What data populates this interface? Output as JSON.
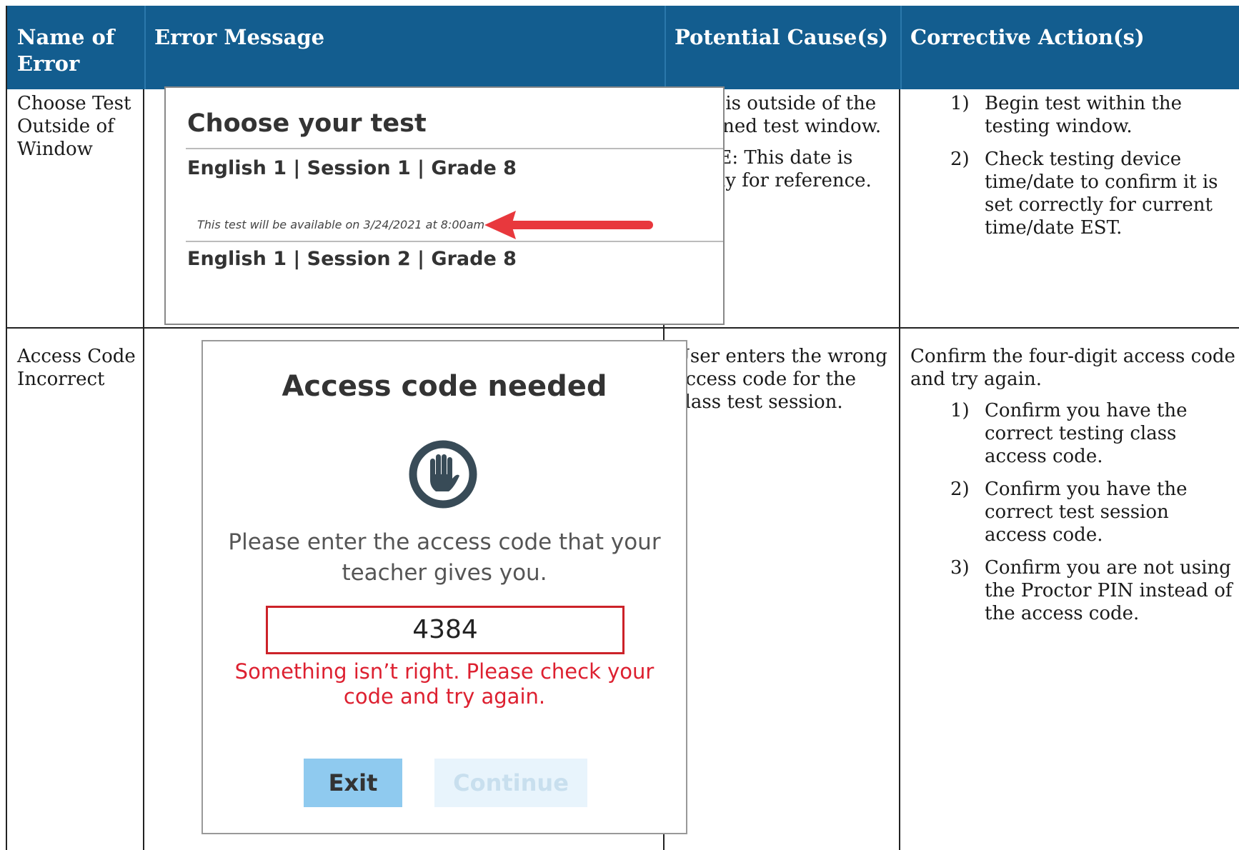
{
  "header": {
    "col1": "Name of Error",
    "col2": "Error Message",
    "col3": "Potential Cause(s)",
    "col4": "Corrective Action(s)"
  },
  "rows": [
    {
      "name": "Choose Test Outside of Window",
      "cause": [
        "User is outside of the assigned test window.",
        "NOTE: This date is simply for reference."
      ],
      "actions": {
        "intro": "",
        "steps": [
          {
            "num": "1)",
            "text": "Begin test within the testing window."
          },
          {
            "num": "2)",
            "text": "Check testing device time/date to confirm it is set correctly for current time/date EST."
          }
        ]
      },
      "screenshot": {
        "title": "Choose your test",
        "item1": "English 1 | Session 1 | Grade 8",
        "note": "This test will be available on 3/24/2021 at 8:00am",
        "item2": "English 1 | Session 2 | Grade 8",
        "arrow_icon": "red-arrow-left",
        "arrow_color": "#e8383d"
      }
    },
    {
      "name": "Access Code Incorrect",
      "cause": [
        "User enters the wrong access code for the class test session."
      ],
      "actions": {
        "intro": "Confirm the four-digit access code and try again.",
        "steps": [
          {
            "num": "1)",
            "text": "Confirm you have the correct testing class access code."
          },
          {
            "num": "2)",
            "text": "Confirm you have the correct test session access code."
          },
          {
            "num": "3)",
            "text": "Confirm you are not using the Proctor PIN instead of the access code."
          }
        ]
      },
      "screenshot": {
        "title": "Access code needed",
        "icon": "stop-hand-icon",
        "message": "Please enter the access code that your teacher gives you.",
        "input_value": "4384",
        "error": "Something isn’t right. Please check your code and try again.",
        "exit_label": "Exit",
        "continue_label": "Continue",
        "error_color": "#dd2030"
      }
    }
  ],
  "colors": {
    "header_bg": "#135d8f",
    "header_text": "#ffffff"
  }
}
